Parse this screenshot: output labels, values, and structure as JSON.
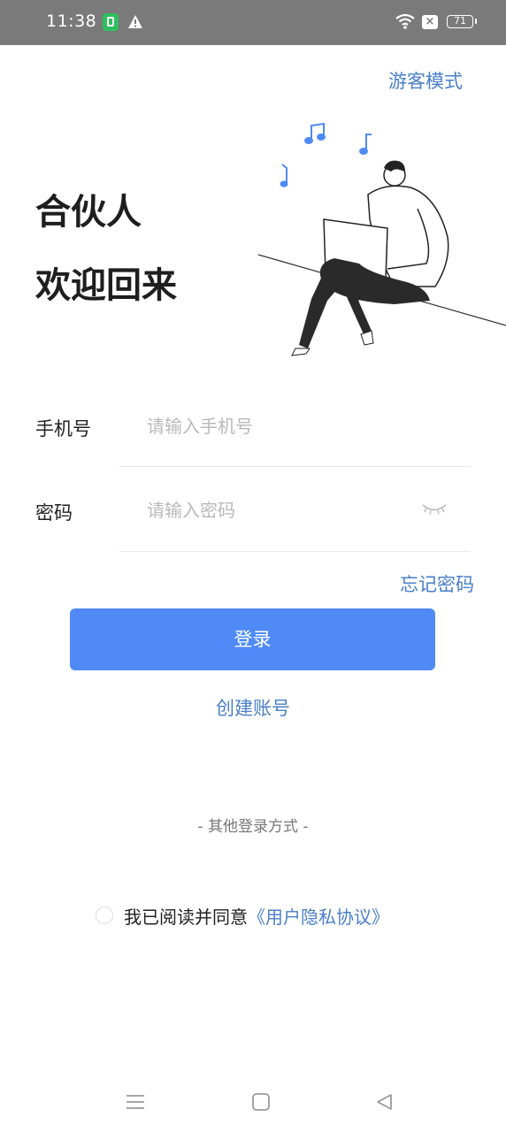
{
  "status_bar": {
    "time": "11:38",
    "battery": "71",
    "icons": [
      "app-notification-icon",
      "warning-icon",
      "wifi-icon",
      "sim-icon",
      "battery-icon"
    ]
  },
  "header": {
    "guest_mode": "游客模式"
  },
  "welcome": {
    "line1": "合伙人",
    "line2": "欢迎回来"
  },
  "form": {
    "phone_label": "手机号",
    "phone_placeholder": "请输入手机号",
    "phone_value": "",
    "password_label": "密码",
    "password_placeholder": "请输入密码",
    "password_value": "",
    "forgot_password": "忘记密码"
  },
  "actions": {
    "login": "登录",
    "create_account": "创建账号",
    "other_login": "- 其他登录方式 -"
  },
  "agreement": {
    "text": "我已阅读并同意",
    "link": "《用户隐私协议》",
    "checked": false
  },
  "colors": {
    "accent": "#4f8af6",
    "link": "#4a7fc9",
    "status_bar": "#7a7a7a"
  },
  "nav_bar": {
    "icons": [
      "menu-icon",
      "home-icon",
      "back-icon"
    ]
  }
}
